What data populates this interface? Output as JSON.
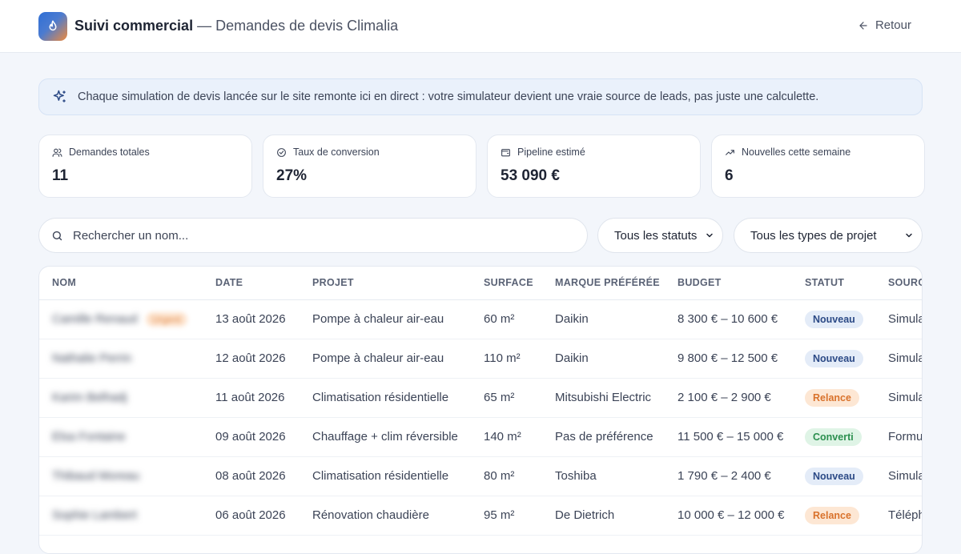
{
  "header": {
    "app_title": "Suivi commercial",
    "subtitle": "— Demandes de devis Climalia",
    "back_label": "Retour"
  },
  "banner": {
    "text": "Chaque simulation de devis lancée sur le site remonte ici en direct : votre simulateur devient une vraie source de leads, pas juste une calculette."
  },
  "stats": [
    {
      "label": "Demandes totales",
      "value": "11",
      "icon": "users-icon"
    },
    {
      "label": "Taux de conversion",
      "value": "27%",
      "icon": "check-circle-icon"
    },
    {
      "label": "Pipeline estimé",
      "value": "53 090 €",
      "icon": "wallet-icon"
    },
    {
      "label": "Nouvelles cette semaine",
      "value": "6",
      "icon": "trending-up-icon"
    }
  ],
  "filters": {
    "search_placeholder": "Rechercher un nom...",
    "status_select": "Tous les statuts",
    "type_select": "Tous les types de projet"
  },
  "table": {
    "columns": [
      "NOM",
      "DATE",
      "PROJET",
      "SURFACE",
      "MARQUE PRÉFÉRÉE",
      "BUDGET",
      "STATUT",
      "SOURCE"
    ],
    "rows": [
      {
        "name": "Camille Renaud",
        "tag": "Urgent",
        "date": "13 août 2026",
        "project": "Pompe à chaleur air-eau",
        "surface": "60 m²",
        "brand": "Daikin",
        "budget": "8 300 € – 10 600 €",
        "status": "Nouveau",
        "source": "Simulateur"
      },
      {
        "name": "Nathalie Perrin",
        "tag": "",
        "date": "12 août 2026",
        "project": "Pompe à chaleur air-eau",
        "surface": "110 m²",
        "brand": "Daikin",
        "budget": "9 800 € – 12 500 €",
        "status": "Nouveau",
        "source": "Simulateur"
      },
      {
        "name": "Karim Belhadj",
        "tag": "",
        "date": "11 août 2026",
        "project": "Climatisation résidentielle",
        "surface": "65 m²",
        "brand": "Mitsubishi Electric",
        "budget": "2 100 € – 2 900 €",
        "status": "Relance",
        "source": "Simulateur"
      },
      {
        "name": "Elsa Fontaine",
        "tag": "",
        "date": "09 août 2026",
        "project": "Chauffage + clim réversible",
        "surface": "140 m²",
        "brand": "Pas de préférence",
        "budget": "11 500 € – 15 000 €",
        "status": "Converti",
        "source": "Formulaire"
      },
      {
        "name": "Thibaud Moreau",
        "tag": "",
        "date": "08 août 2026",
        "project": "Climatisation résidentielle",
        "surface": "80 m²",
        "brand": "Toshiba",
        "budget": "1 790 € – 2 400 €",
        "status": "Nouveau",
        "source": "Simulateur"
      },
      {
        "name": "Sophie Lambert",
        "tag": "",
        "date": "06 août 2026",
        "project": "Rénovation chaudière",
        "surface": "95 m²",
        "brand": "De Dietrich",
        "budget": "10 000 € – 12 000 €",
        "status": "Relance",
        "source": "Téléphone"
      }
    ]
  },
  "colors": {
    "accent": "#2f6fd6",
    "nouveau": "#2c4a86",
    "relance": "#d9722c",
    "converti": "#2b8f4f"
  }
}
